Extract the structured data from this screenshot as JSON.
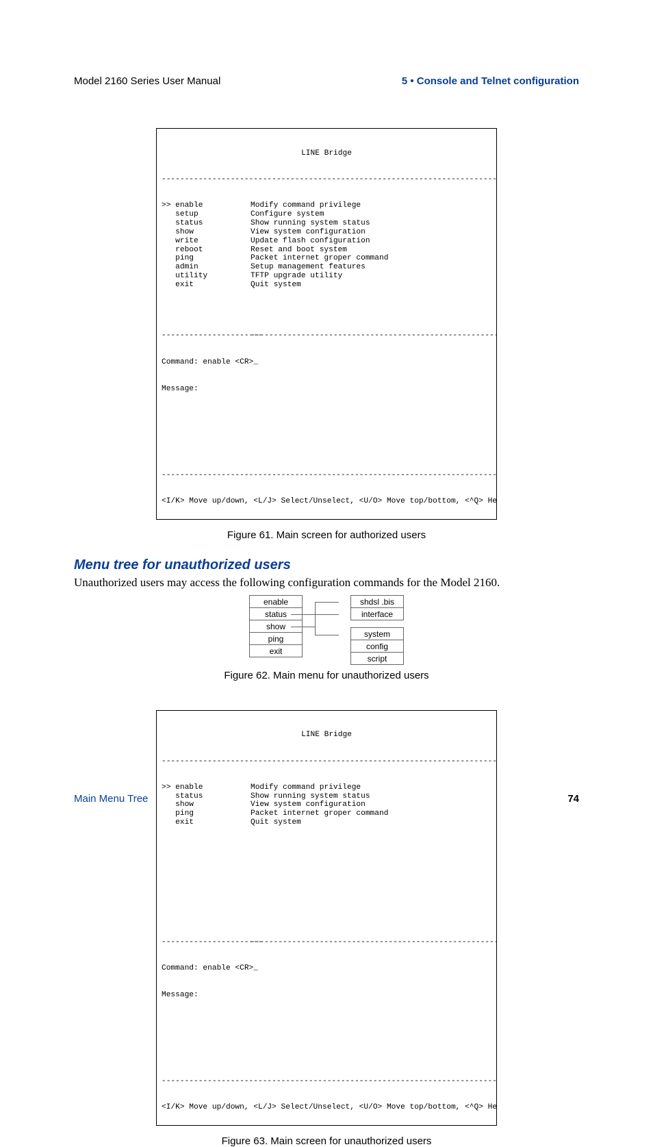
{
  "header": {
    "left": "Model 2160 Series User Manual",
    "right": "5 • Console and Telnet configuration"
  },
  "footer": {
    "left": "Main Menu Tree",
    "right": "74"
  },
  "terminal1": {
    "title": "LINE Bridge",
    "dashline": "-----------------------------------------------------------------------------",
    "menu_left": [
      ">> enable",
      "   setup",
      "   status",
      "   show",
      "   write",
      "   reboot",
      "   ping",
      "   admin",
      "   utility",
      "   exit"
    ],
    "menu_right": [
      "Modify command privilege",
      "Configure system",
      "Show running system status",
      "View system configuration",
      "Update flash configuration",
      "Reset and boot system",
      "Packet internet groper command",
      "Setup management features",
      "TFTP upgrade utility",
      "Quit system"
    ],
    "split_left": "----------------------",
    "split_right": "-------------------------------------------------------",
    "cmd_line": "Command: enable <CR>_",
    "msg_line": "Message:",
    "help_line": "<I/K> Move up/down, <L/J> Select/Unselect, <U/O> Move top/bottom, <^Q> Help"
  },
  "caption1": "Figure 61. Main screen for authorized users",
  "section_heading": "Menu tree for unauthorized users",
  "section_body": "Unauthorized users may access the following configuration commands for the Model 2160.",
  "tree": {
    "left": [
      "enable",
      "status",
      "show",
      "ping",
      "exit"
    ],
    "right": [
      "shdsl .bis",
      "interface",
      "system",
      "config",
      "script"
    ]
  },
  "caption2": "Figure 62. Main menu for unauthorized users",
  "terminal2": {
    "title": "LINE Bridge",
    "dashline": "-----------------------------------------------------------------------------",
    "menu_left": [
      ">> enable",
      "   status",
      "   show",
      "   ping",
      "   exit"
    ],
    "menu_right": [
      "Modify command privilege",
      "Show running system status",
      "View system configuration",
      "Packet internet groper command",
      "Quit system"
    ],
    "split_left": "----------------------",
    "split_right": "-------------------------------------------------------",
    "cmd_line": "Command: enable <CR>_",
    "msg_line": "Message:",
    "help_line": "<I/K> Move up/down, <L/J> Select/Unselect, <U/O> Move top/bottom, <^Q> Help"
  },
  "caption3": "Figure 63. Main screen for unauthorized users"
}
